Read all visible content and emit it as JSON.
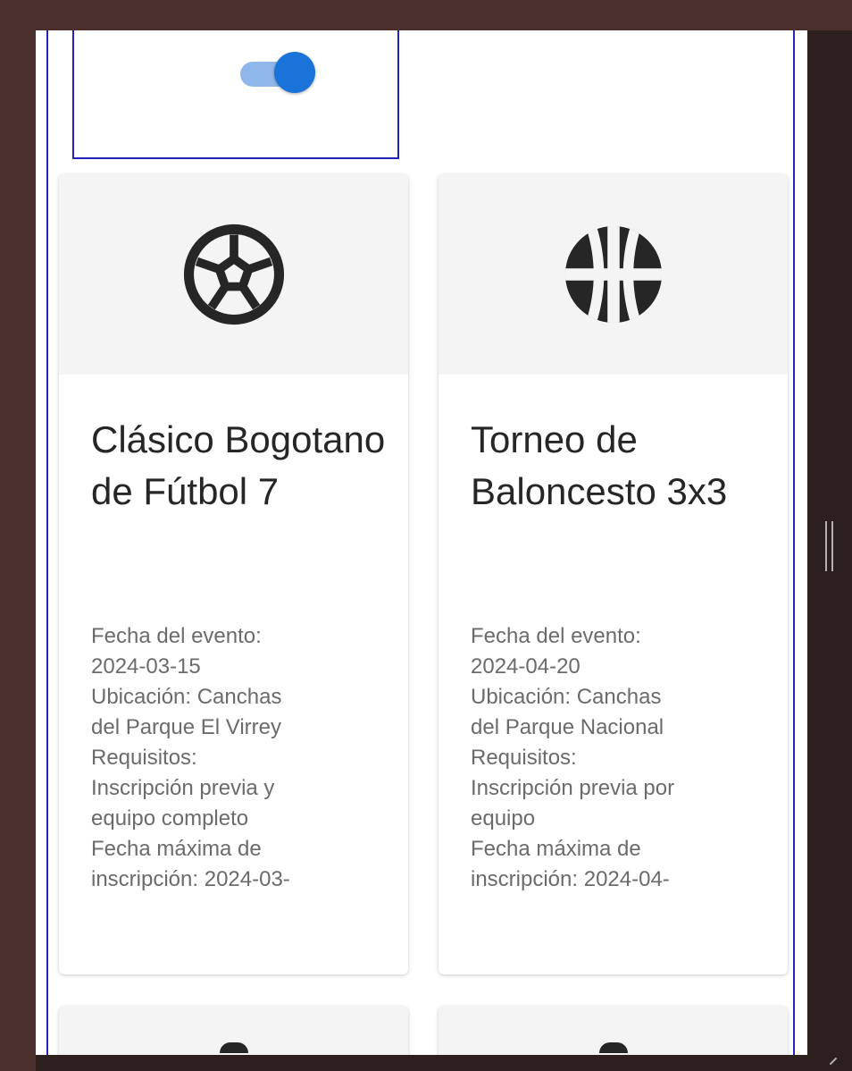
{
  "toggle": {
    "checked": true,
    "colors": {
      "track": "#8fb8ea",
      "thumb": "#1a73d9"
    }
  },
  "events": [
    {
      "icon": "soccer-ball-icon",
      "title": "Clásico Bogotano de Fútbol 7",
      "details": [
        "Fecha del evento:",
        "2024-03-15",
        "Ubicación: Canchas",
        "del Parque El Virrey",
        "Requisitos:",
        "Inscripción previa y",
        "equipo completo",
        "Fecha máxima de",
        "inscripción: 2024-03-"
      ]
    },
    {
      "icon": "basketball-icon",
      "title": "Torneo de Baloncesto 3x3",
      "details": [
        "Fecha del evento:",
        "2024-04-20",
        "Ubicación: Canchas",
        "del Parque Nacional",
        "Requisitos:",
        "Inscripción previa por",
        "equipo",
        "Fecha máxima de",
        "inscripción: 2024-04-"
      ]
    }
  ],
  "colors": {
    "accent": "#1a73d9",
    "frame": "#2525b8",
    "icon": "#262626"
  }
}
